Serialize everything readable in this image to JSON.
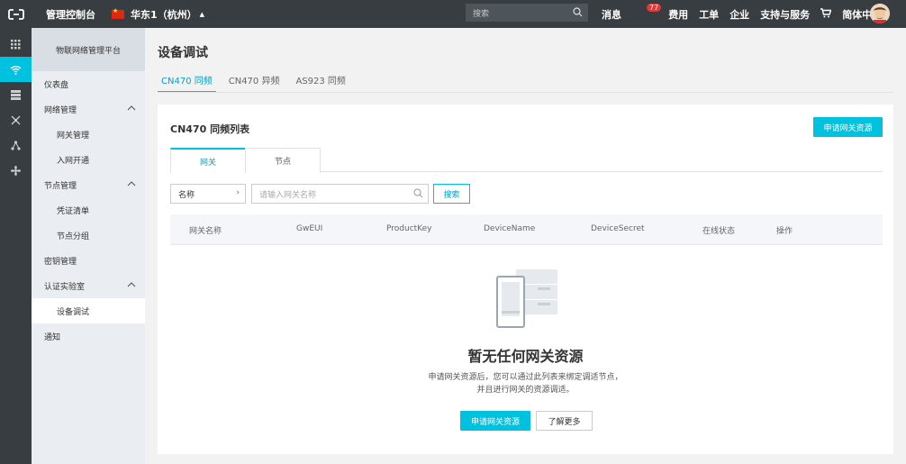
{
  "topbar": {
    "console_label": "管理控制台",
    "region_label": "华东1（杭州）",
    "search_placeholder": "搜索",
    "messages_label": "消息",
    "messages_count": "77",
    "fees_label": "费用",
    "tickets_label": "工单",
    "enterprise_label": "企业",
    "support_label": "支持与服务",
    "language_label": "简体中文"
  },
  "sidebar": {
    "title": "物联网络管理平台",
    "items": [
      {
        "label": "仪表盘"
      },
      {
        "label": "网络管理"
      },
      {
        "label": "网关管理"
      },
      {
        "label": "入网开通"
      },
      {
        "label": "节点管理"
      },
      {
        "label": "凭证清单"
      },
      {
        "label": "节点分组"
      },
      {
        "label": "密钥管理"
      },
      {
        "label": "认证实验室"
      },
      {
        "label": "设备调试"
      },
      {
        "label": "通知"
      }
    ]
  },
  "page": {
    "title": "设备调试",
    "tabs": [
      {
        "label": "CN470 同频"
      },
      {
        "label": "CN470 异频"
      },
      {
        "label": "AS923 同频"
      }
    ]
  },
  "card": {
    "title": "CN470 同频列表",
    "apply_button": "申请网关资源",
    "subtabs": [
      {
        "label": "网关"
      },
      {
        "label": "节点"
      }
    ],
    "filter_select": "名称",
    "filter_placeholder": "请输入网关名称",
    "search_button": "搜索",
    "columns": [
      "网关名称",
      "GwEUI",
      "ProductKey",
      "DeviceName",
      "DeviceSecret",
      "在线状态",
      "操作"
    ],
    "empty_title": "暂无任何网关资源",
    "empty_desc_line1": "申请网关资源后，您可以通过此列表来绑定调适节点，",
    "empty_desc_line2": "并且进行网关的资源调适。",
    "empty_apply_button": "申请网关资源",
    "learn_more_button": "了解更多"
  },
  "colors": {
    "accent": "#00c1de",
    "topbar_bg": "#373d41",
    "sidebar_bg": "#eaedf1"
  }
}
